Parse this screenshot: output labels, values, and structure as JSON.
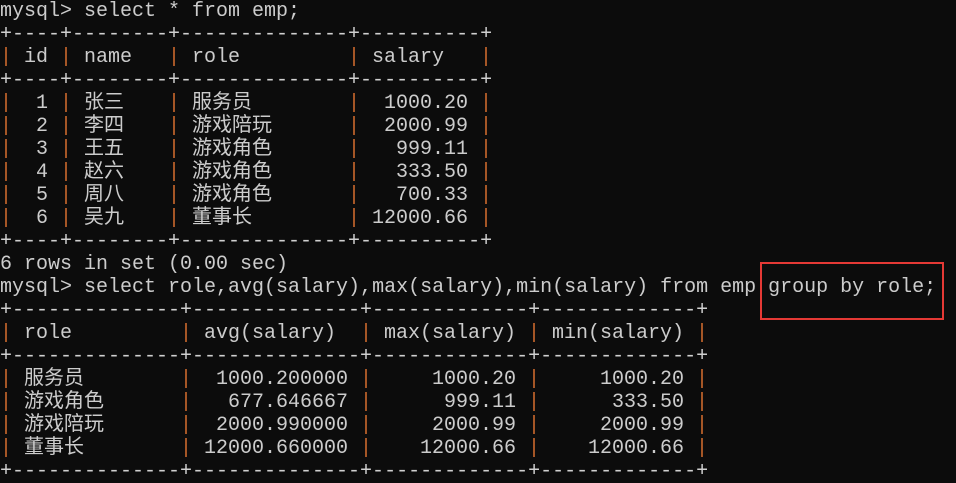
{
  "prompt": "mysql> ",
  "query1": "select * from emp;",
  "table1": {
    "columns": [
      {
        "label": "id",
        "width": 4,
        "align": "right"
      },
      {
        "label": "name",
        "width": 8,
        "align": "left"
      },
      {
        "label": "role",
        "width": 14,
        "align": "left"
      },
      {
        "label": "salary",
        "width": 10,
        "align": "right"
      }
    ],
    "rows": [
      [
        "1",
        "张三",
        "服务员",
        "1000.20"
      ],
      [
        "2",
        "李四",
        "游戏陪玩",
        "2000.99"
      ],
      [
        "3",
        "王五",
        "游戏角色",
        "999.11"
      ],
      [
        "4",
        "赵六",
        "游戏角色",
        "333.50"
      ],
      [
        "5",
        "周八",
        "游戏角色",
        "700.33"
      ],
      [
        "6",
        "吴九",
        "董事长",
        "12000.66"
      ]
    ]
  },
  "status1": "6 rows in set (0.00 sec)",
  "query2": "select role,avg(salary),max(salary),min(salary) from emp group by role;",
  "table2": {
    "columns": [
      {
        "label": "role",
        "width": 14,
        "align": "left"
      },
      {
        "label": "avg(salary)",
        "width": 14,
        "align": "right"
      },
      {
        "label": "max(salary)",
        "width": 13,
        "align": "right"
      },
      {
        "label": "min(salary)",
        "width": 13,
        "align": "right"
      }
    ],
    "rows": [
      [
        "服务员",
        "1000.200000",
        "1000.20",
        "1000.20"
      ],
      [
        "游戏角色",
        "677.646667",
        "999.11",
        "333.50"
      ],
      [
        "游戏陪玩",
        "2000.990000",
        "2000.99",
        "2000.99"
      ],
      [
        "董事长",
        "12000.660000",
        "12000.66",
        "12000.66"
      ]
    ]
  },
  "colors": {
    "background": "#0c0c0c",
    "text": "#cccccc",
    "pipe": "#c8672c",
    "highlight": "#e53935"
  }
}
